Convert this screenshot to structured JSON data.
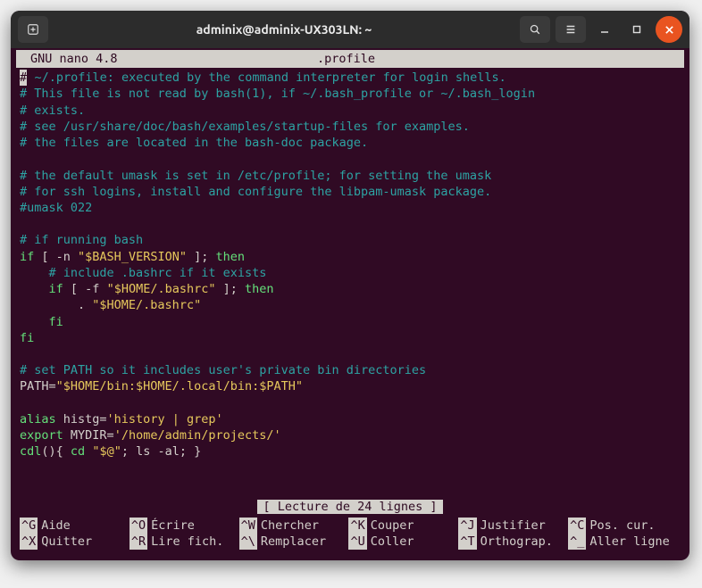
{
  "window": {
    "title": "adminix@adminix-UX303LN: ~"
  },
  "nano": {
    "app_name": "GNU nano 4.8",
    "filename": ".profile",
    "status": "[ Lecture de 24 lignes ]"
  },
  "file": {
    "l1": " ~/.profile: executed by the command interpreter for login shells.",
    "l2": "# This file is not read by bash(1), if ~/.bash_profile or ~/.bash_login",
    "l3": "# exists.",
    "l4": "# see /usr/share/doc/bash/examples/startup-files for examples.",
    "l5": "# the files are located in the bash-doc package.",
    "l6": "# the default umask is set in /etc/profile; for setting the umask",
    "l7": "# for ssh logins, install and configure the libpam-umask package.",
    "l8": "#umask 022",
    "l9": "# if running bash",
    "l10a": "if",
    "l10b": " [ -n ",
    "l10c": "\"$BASH_VERSION\"",
    "l10d": " ]; ",
    "l10e": "then",
    "l11": "    # include .bashrc if it exists",
    "l12a": "    if",
    "l12b": " [ -f ",
    "l12c": "\"$HOME/.bashrc\"",
    "l12d": " ]; ",
    "l12e": "then",
    "l13a": "        . ",
    "l13b": "\"$HOME/.bashrc\"",
    "l14": "    fi",
    "l15": "fi",
    "l16": "# set PATH so it includes user's private bin directories",
    "l17a": "PATH=",
    "l17b": "\"$HOME/bin:$HOME/.local/bin:$PATH\"",
    "l18a": "alias",
    "l18b": " histg=",
    "l18c": "'history | grep'",
    "l19a": "export",
    "l19b": " MYDIR=",
    "l19c": "'/home/admin/projects/'",
    "l20a": "cdl",
    "l20b": "(){ ",
    "l20c": "cd",
    "l20d": " ",
    "l20e": "\"$@\"",
    "l20f": "; ls -al; }"
  },
  "shortcuts": {
    "g": {
      "key": "^G",
      "label": "Aide"
    },
    "o": {
      "key": "^O",
      "label": "Écrire"
    },
    "w": {
      "key": "^W",
      "label": "Chercher"
    },
    "k": {
      "key": "^K",
      "label": "Couper"
    },
    "j": {
      "key": "^J",
      "label": "Justifier"
    },
    "c": {
      "key": "^C",
      "label": "Pos. cur."
    },
    "x": {
      "key": "^X",
      "label": "Quitter"
    },
    "r": {
      "key": "^R",
      "label": "Lire fich."
    },
    "bs": {
      "key": "^\\",
      "label": "Remplacer"
    },
    "u": {
      "key": "^U",
      "label": "Coller"
    },
    "t": {
      "key": "^T",
      "label": "Orthograp."
    },
    "ul": {
      "key": "^_",
      "label": "Aller ligne"
    }
  }
}
